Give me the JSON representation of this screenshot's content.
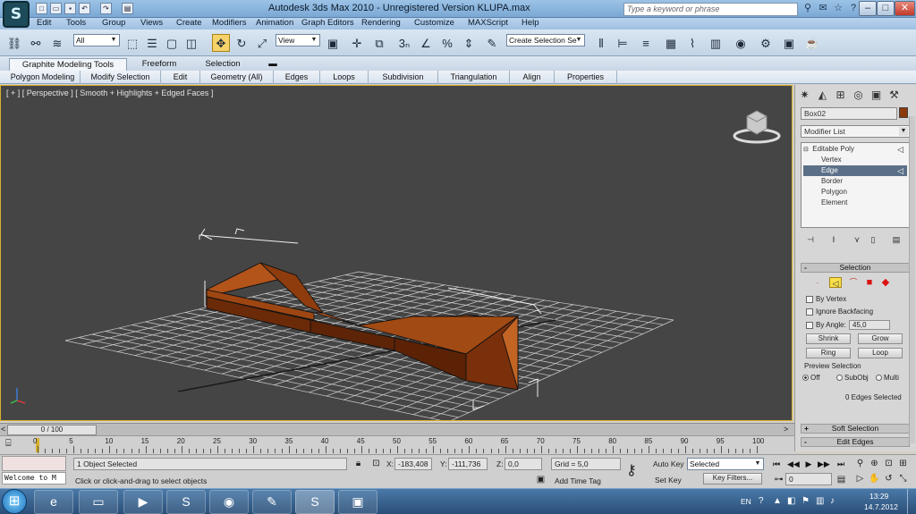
{
  "app": {
    "logo": "S",
    "title": "Autodesk 3ds Max  2010    -   Unregistered Version      KLUPA.max",
    "search_placeholder": "Type a keyword or phrase"
  },
  "menu": [
    "Edit",
    "Tools",
    "Group",
    "Views",
    "Create",
    "Modifiers",
    "Animation",
    "Graph Editors",
    "Rendering",
    "Customize",
    "MAXScript",
    "Help"
  ],
  "toolbar": {
    "selection_filter": "All",
    "coord_system": "View",
    "named_selection": "Create Selection Se"
  },
  "ribbon": {
    "tabs": [
      "Graphite Modeling Tools",
      "Freeform",
      "Selection"
    ],
    "sections": [
      "Polygon Modeling",
      "Modify Selection",
      "Edit",
      "Geometry (All)",
      "Edges",
      "Loops",
      "Subdivision",
      "Triangulation",
      "Align",
      "Properties"
    ]
  },
  "viewport": {
    "label": "[ + ] [ Perspective ] [ Smooth + Highlights + Edged Faces ]",
    "object_color": "#8b3a0d"
  },
  "command_panel": {
    "object_name": "Box02",
    "modifier_list": "Modifier List",
    "stack": [
      {
        "label": "Editable Poly",
        "selected": false
      },
      {
        "label": "Vertex",
        "selected": false
      },
      {
        "label": "Edge",
        "selected": true
      },
      {
        "label": "Border",
        "selected": false
      },
      {
        "label": "Polygon",
        "selected": false
      },
      {
        "label": "Element",
        "selected": false
      }
    ],
    "selection_rollout": {
      "title": "Selection",
      "by_vertex": "By Vertex",
      "ignore_backfacing": "Ignore Backfacing",
      "by_angle": "By Angle:",
      "angle_value": "45,0",
      "shrink": "Shrink",
      "grow": "Grow",
      "ring": "Ring",
      "loop": "Loop",
      "preview_selection": "Preview Selection",
      "preview_options": [
        "Off",
        "SubObj",
        "Multi"
      ],
      "status": "0 Edges Selected"
    },
    "soft_selection": "Soft Selection",
    "edit_edges": "Edit Edges"
  },
  "timeline": {
    "frame": "0 / 100",
    "ticks": [
      "0",
      "5",
      "10",
      "15",
      "20",
      "25",
      "30",
      "35",
      "40",
      "45",
      "50",
      "55",
      "60",
      "65",
      "70",
      "75",
      "80",
      "85",
      "90",
      "95",
      "100"
    ]
  },
  "status": {
    "listener": "Welcome to M",
    "selection_info": "1 Object Selected",
    "prompt": "Click or click-and-drag to select objects",
    "x_label": "X:",
    "x_value": "-183,408",
    "y_label": "Y:",
    "y_value": "-111,736",
    "z_label": "Z:",
    "z_value": "0,0",
    "grid": "Grid = 5,0",
    "add_time_tag": "Add Time Tag",
    "auto_key": "Auto Key",
    "set_key": "Set Key",
    "key_mode": "Selected",
    "key_filters": "Key Filters...",
    "current_frame": "0"
  },
  "taskbar": {
    "language": "EN",
    "time": "13:29",
    "date": "14.7.2012"
  }
}
